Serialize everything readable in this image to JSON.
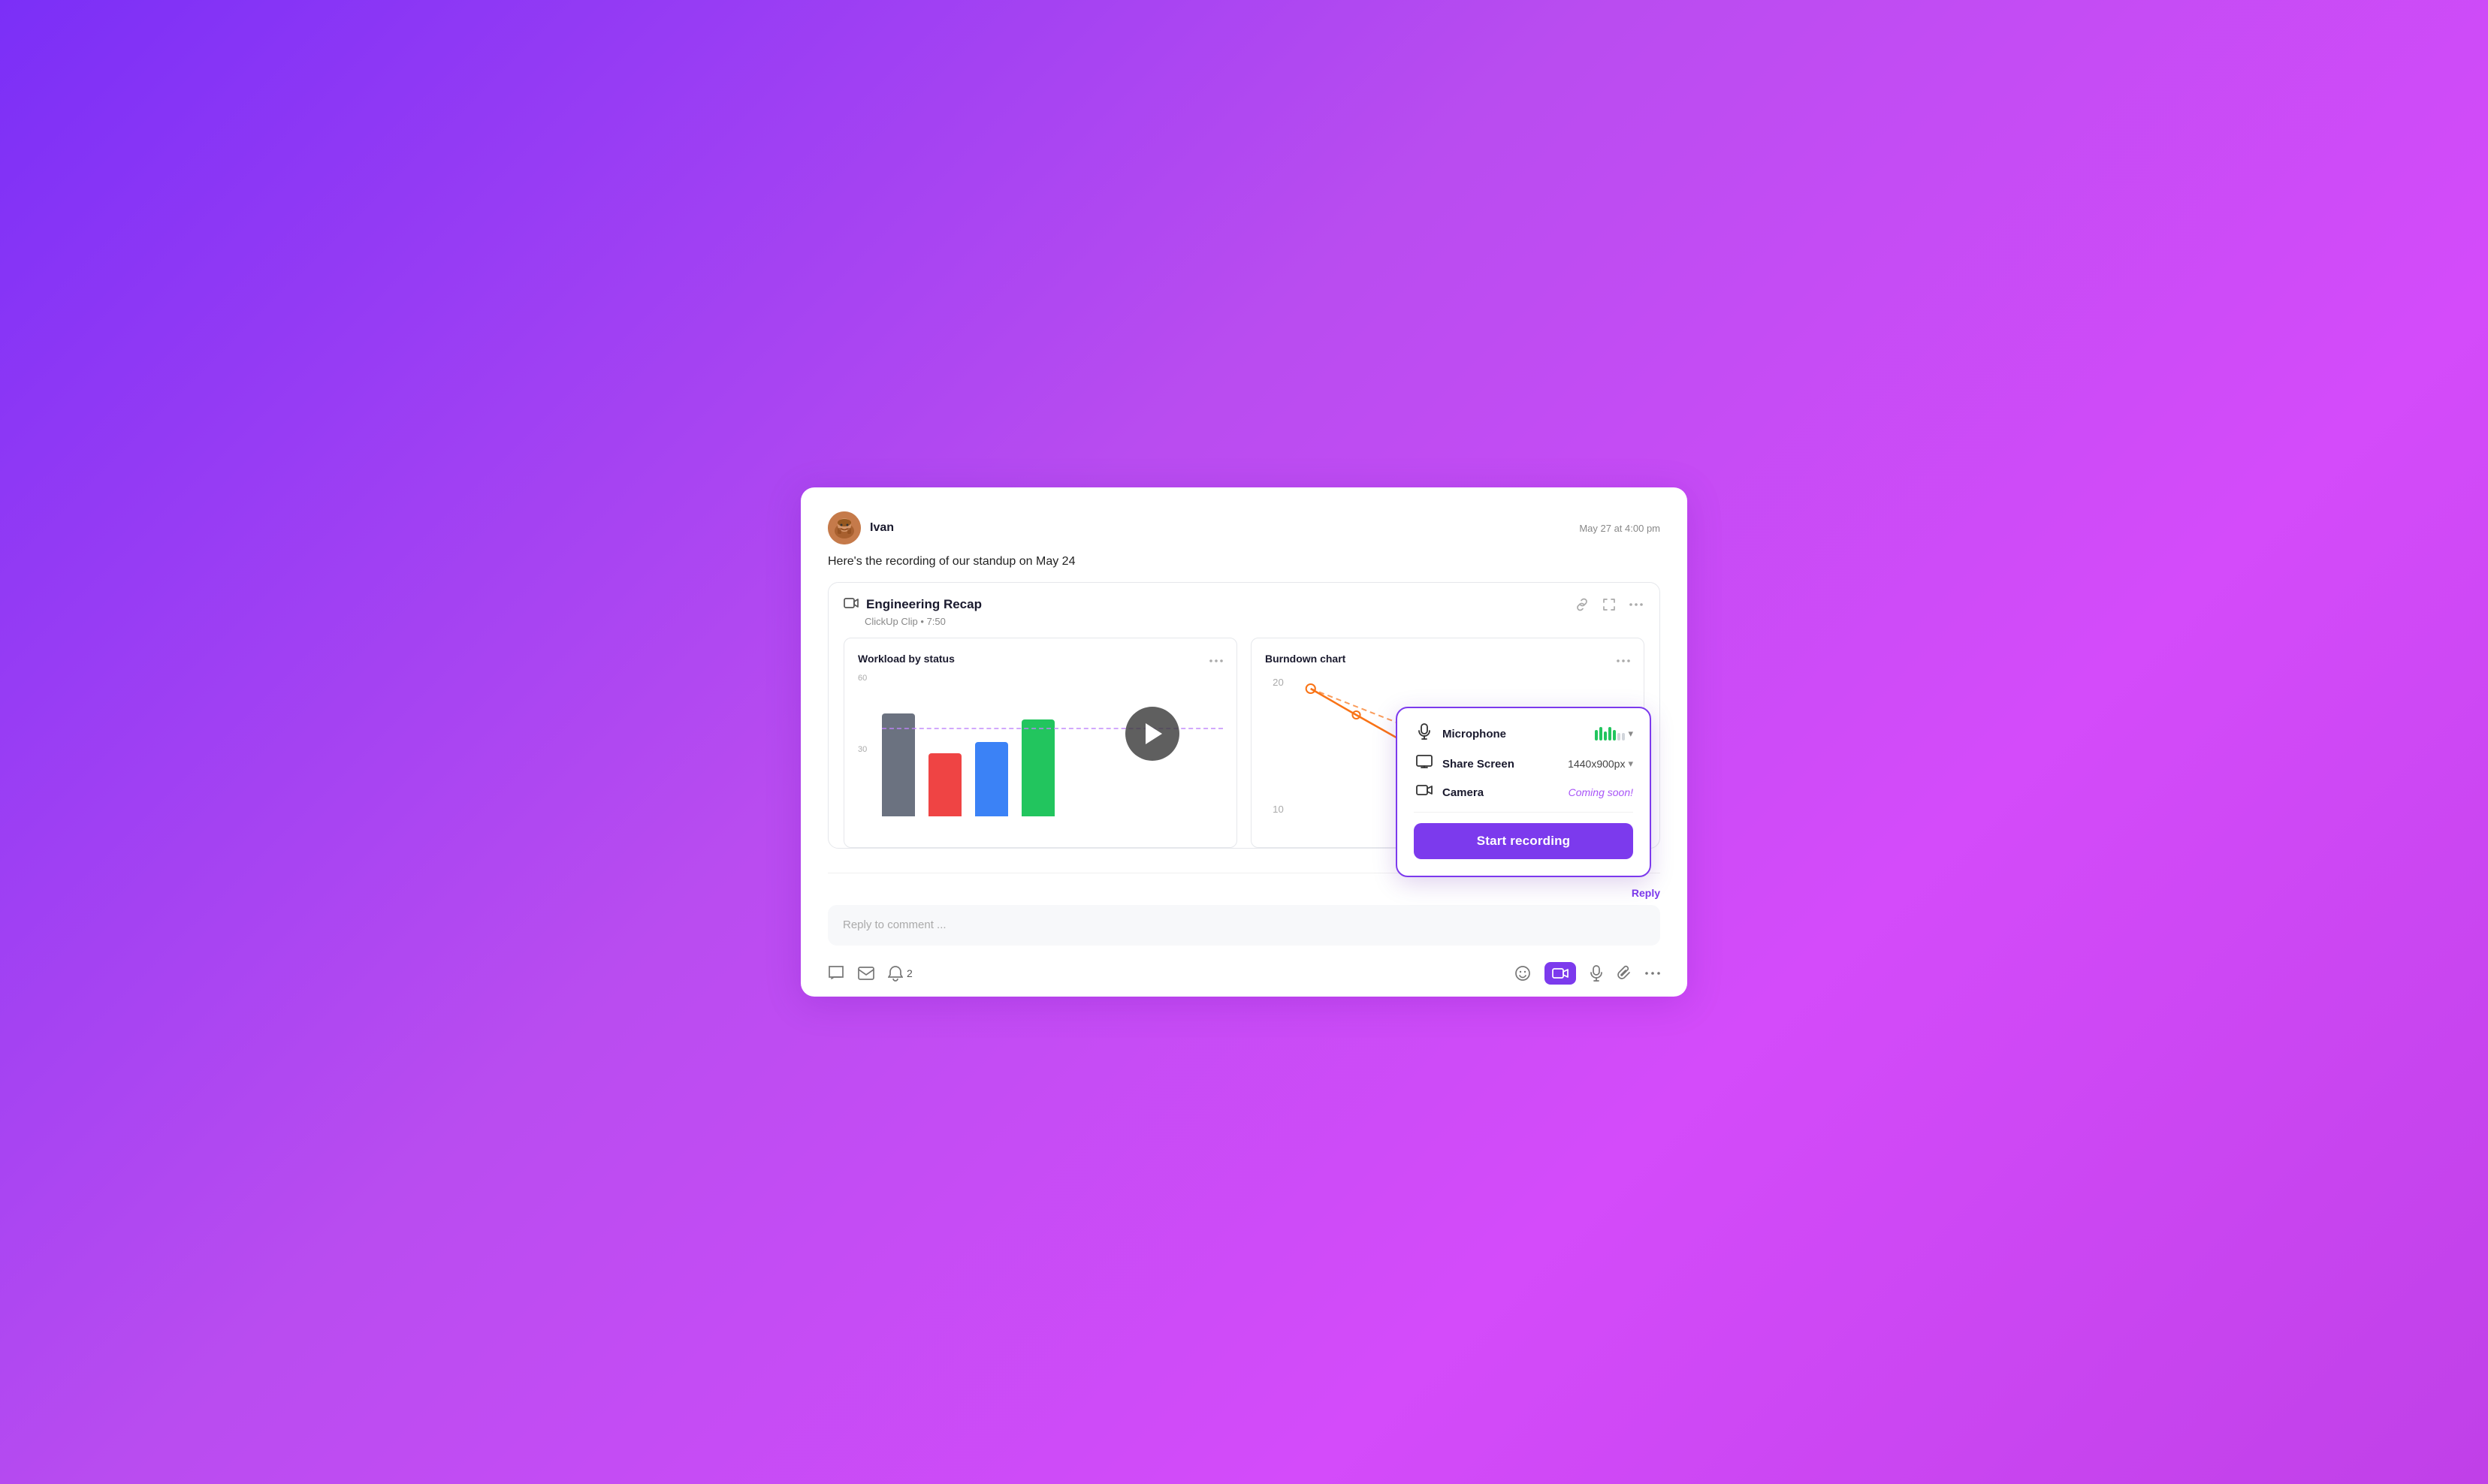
{
  "author": {
    "name": "Ivan",
    "timestamp": "May 27 at 4:00 pm"
  },
  "message": "Here's the recording of our standup on May 24",
  "clip": {
    "title": "Engineering Recap",
    "meta": "ClickUp Clip • 7:50"
  },
  "workload_chart": {
    "title": "Workload by status",
    "y_labels": [
      "60",
      "30"
    ],
    "bars": [
      {
        "color": "#6b7280",
        "height_pct": 72
      },
      {
        "color": "#ef4444",
        "height_pct": 44
      },
      {
        "color": "#3b82f6",
        "height_pct": 52
      },
      {
        "color": "#22c55e",
        "height_pct": 68
      }
    ],
    "dashed_line_pct": 56
  },
  "burndown_chart": {
    "title": "Burndown chart",
    "y_labels": [
      "20",
      "10"
    ]
  },
  "popup": {
    "microphone_label": "Microphone",
    "screen_label": "Share Screen",
    "screen_value": "1440x900px",
    "camera_label": "Camera",
    "camera_coming_soon": "Coming soon!",
    "start_recording_label": "Start recording"
  },
  "reply_bar": {
    "placeholder": "Reply to comment ...",
    "reply_label": "Reply",
    "notification_count": "2"
  },
  "toolbar": {
    "chat_icon": "💬",
    "mail_icon": "✉",
    "bell_icon": "🔔",
    "emoji_icon": "😊",
    "camera_icon": "📹",
    "mic_icon": "🎤",
    "attach_icon": "📎",
    "more_icon": "···",
    "link_icon": "🔗",
    "expand_icon": "⛶",
    "menu_icon": "···"
  }
}
